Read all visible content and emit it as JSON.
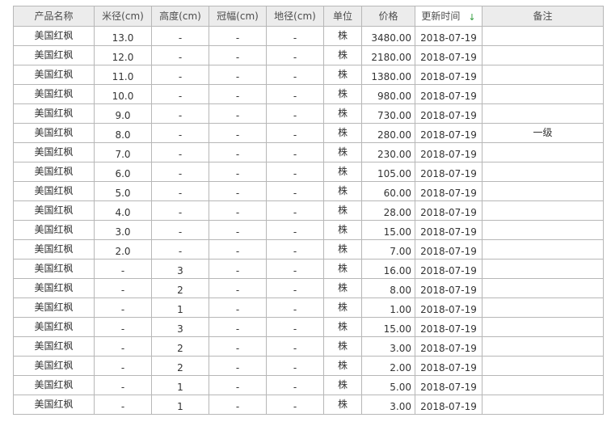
{
  "table": {
    "headers": {
      "name": "产品名称",
      "diameter": "米径(cm)",
      "height": "高度(cm)",
      "crown": "冠幅(cm)",
      "ground": "地径(cm)",
      "unit": "单位",
      "price": "价格",
      "updated": "更新时间",
      "note": "备注"
    },
    "sort_arrow": "↓",
    "rows": [
      {
        "name": "美国红枫",
        "diameter": "13.0",
        "height": "-",
        "crown": "-",
        "ground": "-",
        "unit": "株",
        "price": "3480.00",
        "date": "2018-07-19",
        "note": ""
      },
      {
        "name": "美国红枫",
        "diameter": "12.0",
        "height": "-",
        "crown": "-",
        "ground": "-",
        "unit": "株",
        "price": "2180.00",
        "date": "2018-07-19",
        "note": ""
      },
      {
        "name": "美国红枫",
        "diameter": "11.0",
        "height": "-",
        "crown": "-",
        "ground": "-",
        "unit": "株",
        "price": "1380.00",
        "date": "2018-07-19",
        "note": ""
      },
      {
        "name": "美国红枫",
        "diameter": "10.0",
        "height": "-",
        "crown": "-",
        "ground": "-",
        "unit": "株",
        "price": "980.00",
        "date": "2018-07-19",
        "note": ""
      },
      {
        "name": "美国红枫",
        "diameter": "9.0",
        "height": "-",
        "crown": "-",
        "ground": "-",
        "unit": "株",
        "price": "730.00",
        "date": "2018-07-19",
        "note": ""
      },
      {
        "name": "美国红枫",
        "diameter": "8.0",
        "height": "-",
        "crown": "-",
        "ground": "-",
        "unit": "株",
        "price": "280.00",
        "date": "2018-07-19",
        "note": "一级"
      },
      {
        "name": "美国红枫",
        "diameter": "7.0",
        "height": "-",
        "crown": "-",
        "ground": "-",
        "unit": "株",
        "price": "230.00",
        "date": "2018-07-19",
        "note": ""
      },
      {
        "name": "美国红枫",
        "diameter": "6.0",
        "height": "-",
        "crown": "-",
        "ground": "-",
        "unit": "株",
        "price": "105.00",
        "date": "2018-07-19",
        "note": ""
      },
      {
        "name": "美国红枫",
        "diameter": "5.0",
        "height": "-",
        "crown": "-",
        "ground": "-",
        "unit": "株",
        "price": "60.00",
        "date": "2018-07-19",
        "note": ""
      },
      {
        "name": "美国红枫",
        "diameter": "4.0",
        "height": "-",
        "crown": "-",
        "ground": "-",
        "unit": "株",
        "price": "28.00",
        "date": "2018-07-19",
        "note": ""
      },
      {
        "name": "美国红枫",
        "diameter": "3.0",
        "height": "-",
        "crown": "-",
        "ground": "-",
        "unit": "株",
        "price": "15.00",
        "date": "2018-07-19",
        "note": ""
      },
      {
        "name": "美国红枫",
        "diameter": "2.0",
        "height": "-",
        "crown": "-",
        "ground": "-",
        "unit": "株",
        "price": "7.00",
        "date": "2018-07-19",
        "note": ""
      },
      {
        "name": "美国红枫",
        "diameter": "-",
        "height": "3",
        "crown": "-",
        "ground": "-",
        "unit": "株",
        "price": "16.00",
        "date": "2018-07-19",
        "note": ""
      },
      {
        "name": "美国红枫",
        "diameter": "-",
        "height": "2",
        "crown": "-",
        "ground": "-",
        "unit": "株",
        "price": "8.00",
        "date": "2018-07-19",
        "note": ""
      },
      {
        "name": "美国红枫",
        "diameter": "-",
        "height": "1",
        "crown": "-",
        "ground": "-",
        "unit": "株",
        "price": "1.00",
        "date": "2018-07-19",
        "note": ""
      },
      {
        "name": "美国红枫",
        "diameter": "-",
        "height": "3",
        "crown": "-",
        "ground": "-",
        "unit": "株",
        "price": "15.00",
        "date": "2018-07-19",
        "note": ""
      },
      {
        "name": "美国红枫",
        "diameter": "-",
        "height": "2",
        "crown": "-",
        "ground": "-",
        "unit": "株",
        "price": "3.00",
        "date": "2018-07-19",
        "note": ""
      },
      {
        "name": "美国红枫",
        "diameter": "-",
        "height": "2",
        "crown": "-",
        "ground": "-",
        "unit": "株",
        "price": "2.00",
        "date": "2018-07-19",
        "note": ""
      },
      {
        "name": "美国红枫",
        "diameter": "-",
        "height": "1",
        "crown": "-",
        "ground": "-",
        "unit": "株",
        "price": "5.00",
        "date": "2018-07-19",
        "note": ""
      },
      {
        "name": "美国红枫",
        "diameter": "-",
        "height": "1",
        "crown": "-",
        "ground": "-",
        "unit": "株",
        "price": "3.00",
        "date": "2018-07-19",
        "note": ""
      }
    ]
  },
  "colors": {
    "header_bg": "#ececec",
    "border": "#b7b7b7",
    "sort_arrow": "#2e9b3a"
  }
}
